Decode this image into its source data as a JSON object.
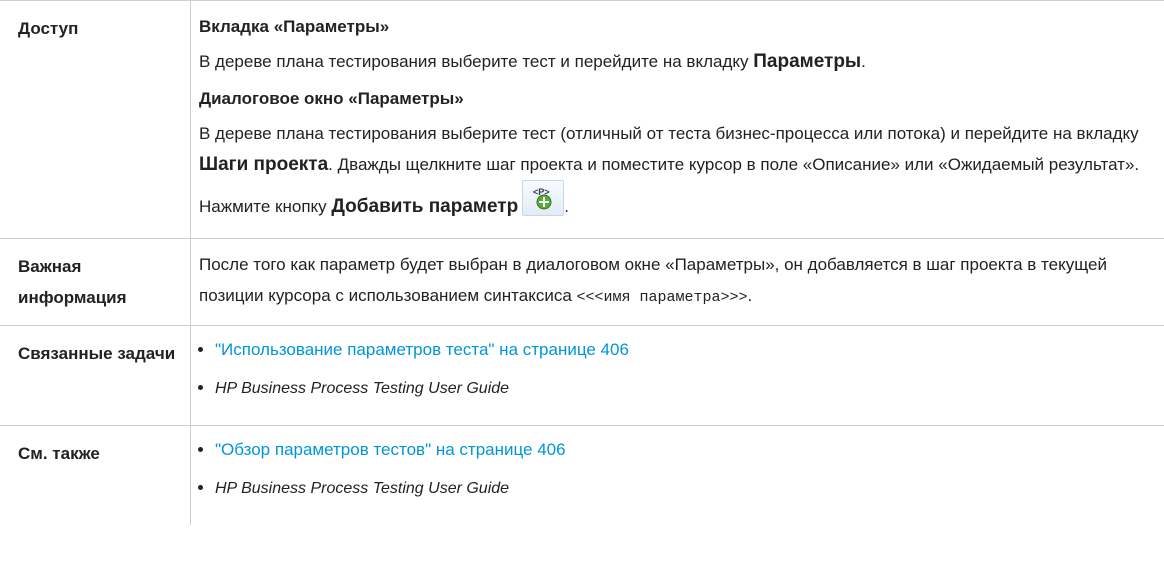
{
  "rows": {
    "access": {
      "label": "Доступ",
      "tab_heading": "Вкладка «Параметры»",
      "tab_text": "В дереве плана тестирования выберите тест и перейдите на вкладку ",
      "tab_bold": "Параметры",
      "tab_end": ".",
      "dialog_heading": "Диалоговое окно «Параметры»",
      "dialog_text1": "В дереве плана тестирования выберите тест (отличный от теста бизнес-процесса или потока) и перейдите на вкладку ",
      "dialog_bold1": "Шаги проекта",
      "dialog_text2": ". Дважды щелкните шаг проекта и поместите курсор в поле «Описание» или «Ожидаемый результат». Нажмите кнопку ",
      "dialog_bold2": "Добавить параметр",
      "dialog_end": ".",
      "button_icon": "add-parameter-icon"
    },
    "important": {
      "label": "Важная информация",
      "text1": "После того как параметр будет выбран в диалоговом окне «Параметры», он добавляется в шаг проекта в текущей позиции курсора с использованием синтаксиса ",
      "code": "<<<имя параметра>>>",
      "text_end": "."
    },
    "related": {
      "label": "Связанные задачи",
      "link": "\"Использование параметров теста\" на странице 406",
      "guide": "HP Business Process Testing User Guide"
    },
    "see_also": {
      "label": "См. также",
      "link": "\"Обзор параметров тестов\" на странице 406",
      "guide": "HP Business Process Testing User Guide"
    }
  },
  "colors": {
    "link": "#0096d6",
    "border": "#cfcfcf"
  }
}
